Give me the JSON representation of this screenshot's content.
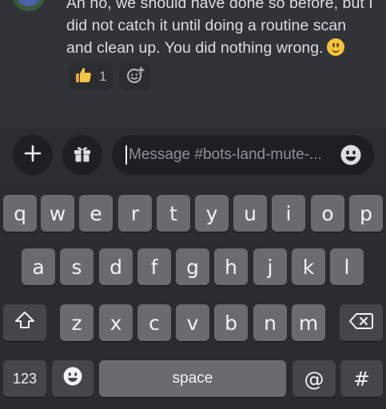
{
  "message": {
    "lines": [
      "Ah no, we should have done so before, but I",
      "did not catch it until doing a routine scan",
      "and clean up. You did nothing wrong."
    ],
    "trailing_emoji": "slightly-smiling-face"
  },
  "reactions": [
    {
      "emoji": "thumbs-up",
      "count": "1"
    }
  ],
  "add_reaction_icon": "add-reaction-icon",
  "composer": {
    "placeholder": "Message #bots-land-mute-...",
    "value": ""
  },
  "keyboard": {
    "row1": [
      "q",
      "w",
      "e",
      "r",
      "t",
      "y",
      "u",
      "i",
      "o",
      "p"
    ],
    "row2": [
      "a",
      "s",
      "d",
      "f",
      "g",
      "h",
      "j",
      "k",
      "l"
    ],
    "row3": [
      "z",
      "x",
      "c",
      "v",
      "b",
      "n",
      "m"
    ],
    "numbers_key": "123",
    "space_key": "space",
    "at_key": "@",
    "hash_key": "#"
  },
  "colors": {
    "chat_bg": "#313338",
    "composer_bg": "#2b2d31",
    "input_bg": "#1e1f22",
    "keyboard_bg": "#2c2c2e",
    "key_bg": "#6b6b6e",
    "key_dark_bg": "#464649"
  }
}
